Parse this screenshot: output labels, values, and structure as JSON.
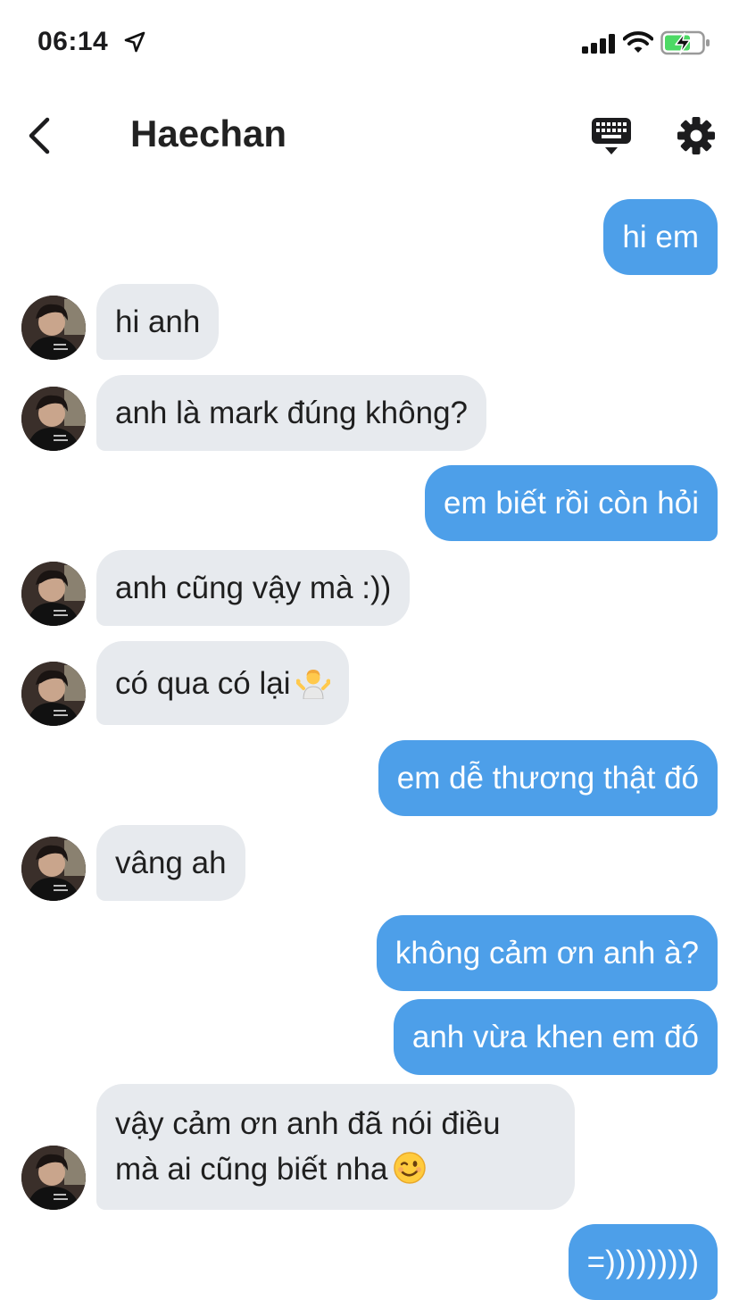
{
  "status_bar": {
    "time": "06:14"
  },
  "header": {
    "title": "Haechan"
  },
  "icons": {
    "back": "chevron-left-icon",
    "keyboard": "keyboard-icon",
    "settings": "gear-icon",
    "location": "location-arrow-icon",
    "signal": "signal-icon",
    "wifi": "wifi-icon",
    "battery": "battery-charging-icon"
  },
  "colors": {
    "outgoing_bubble": "#4d9fe9",
    "incoming_bubble": "#e7eaee",
    "battery_fill": "#4cd964"
  },
  "messages": [
    {
      "sender": "me",
      "text": "hi em"
    },
    {
      "sender": "Haechan",
      "text": "hi anh"
    },
    {
      "sender": "Haechan",
      "text": "anh là mark đúng không?"
    },
    {
      "sender": "me",
      "text": "em biết rồi còn hỏi"
    },
    {
      "sender": "Haechan",
      "text": "anh cũng vậy mà :))"
    },
    {
      "sender": "Haechan",
      "text": "có qua có lại",
      "emoji": "person-shrugging"
    },
    {
      "sender": "me",
      "text": "em dễ thương thật đó"
    },
    {
      "sender": "Haechan",
      "text": "vâng ah"
    },
    {
      "sender": "me",
      "text": "không cảm ơn anh à?"
    },
    {
      "sender": "me",
      "text": "anh vừa khen em đó"
    },
    {
      "sender": "Haechan",
      "lines": [
        "vậy cảm ơn anh đã nói điều",
        "mà ai cũng biết nha"
      ],
      "emoji": "winking-face"
    },
    {
      "sender": "me",
      "text": "=)))))))))"
    }
  ]
}
